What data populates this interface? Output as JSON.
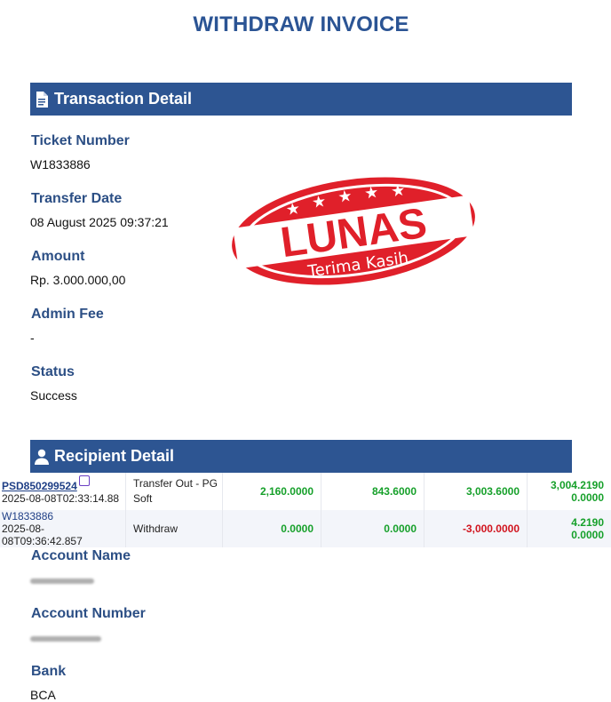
{
  "page": {
    "title": "WITHDRAW INVOICE"
  },
  "transaction": {
    "heading": "Transaction Detail",
    "ticket_label": "Ticket Number",
    "ticket_value": "W1833886",
    "date_label": "Transfer Date",
    "date_value": "08 August 2025 09:37:21",
    "amount_label": "Amount",
    "amount_value": "Rp. 3.000.000,00",
    "fee_label": "Admin Fee",
    "fee_value": "-",
    "status_label": "Status",
    "status_value": "Success"
  },
  "stamp": {
    "main": "LUNAS",
    "sub": "Terima Kasih",
    "color": "#e0202a"
  },
  "recipient": {
    "heading": "Recipient Detail",
    "account_name_label": "Account Name",
    "account_number_label": "Account Number",
    "bank_label": "Bank",
    "bank_value": "BCA"
  },
  "transactions": [
    {
      "id": "PSD850299524",
      "timestamp": "2025-08-08T02:33:14.88",
      "desc": "Transfer Out - PG Soft",
      "c1": "2,160.0000",
      "c2": "843.6000",
      "c3": "3,003.6000",
      "c4a": "3,004.2190",
      "c4b": "0.0000"
    },
    {
      "id": "W1833886",
      "timestamp": "2025-08-08T09:36:42.857",
      "desc": "Withdraw",
      "c1": "0.0000",
      "c2": "0.0000",
      "c3": "-3,000.0000",
      "c4a": "4.2190",
      "c4b": "0.0000"
    }
  ],
  "colors": {
    "header_bg": "#2d5592",
    "label": "#2c4f85",
    "positive": "#16a02a",
    "negative": "#d1141e"
  },
  "icons": {
    "transaction": "document-icon",
    "recipient": "user-icon",
    "copy": "copy-icon"
  }
}
